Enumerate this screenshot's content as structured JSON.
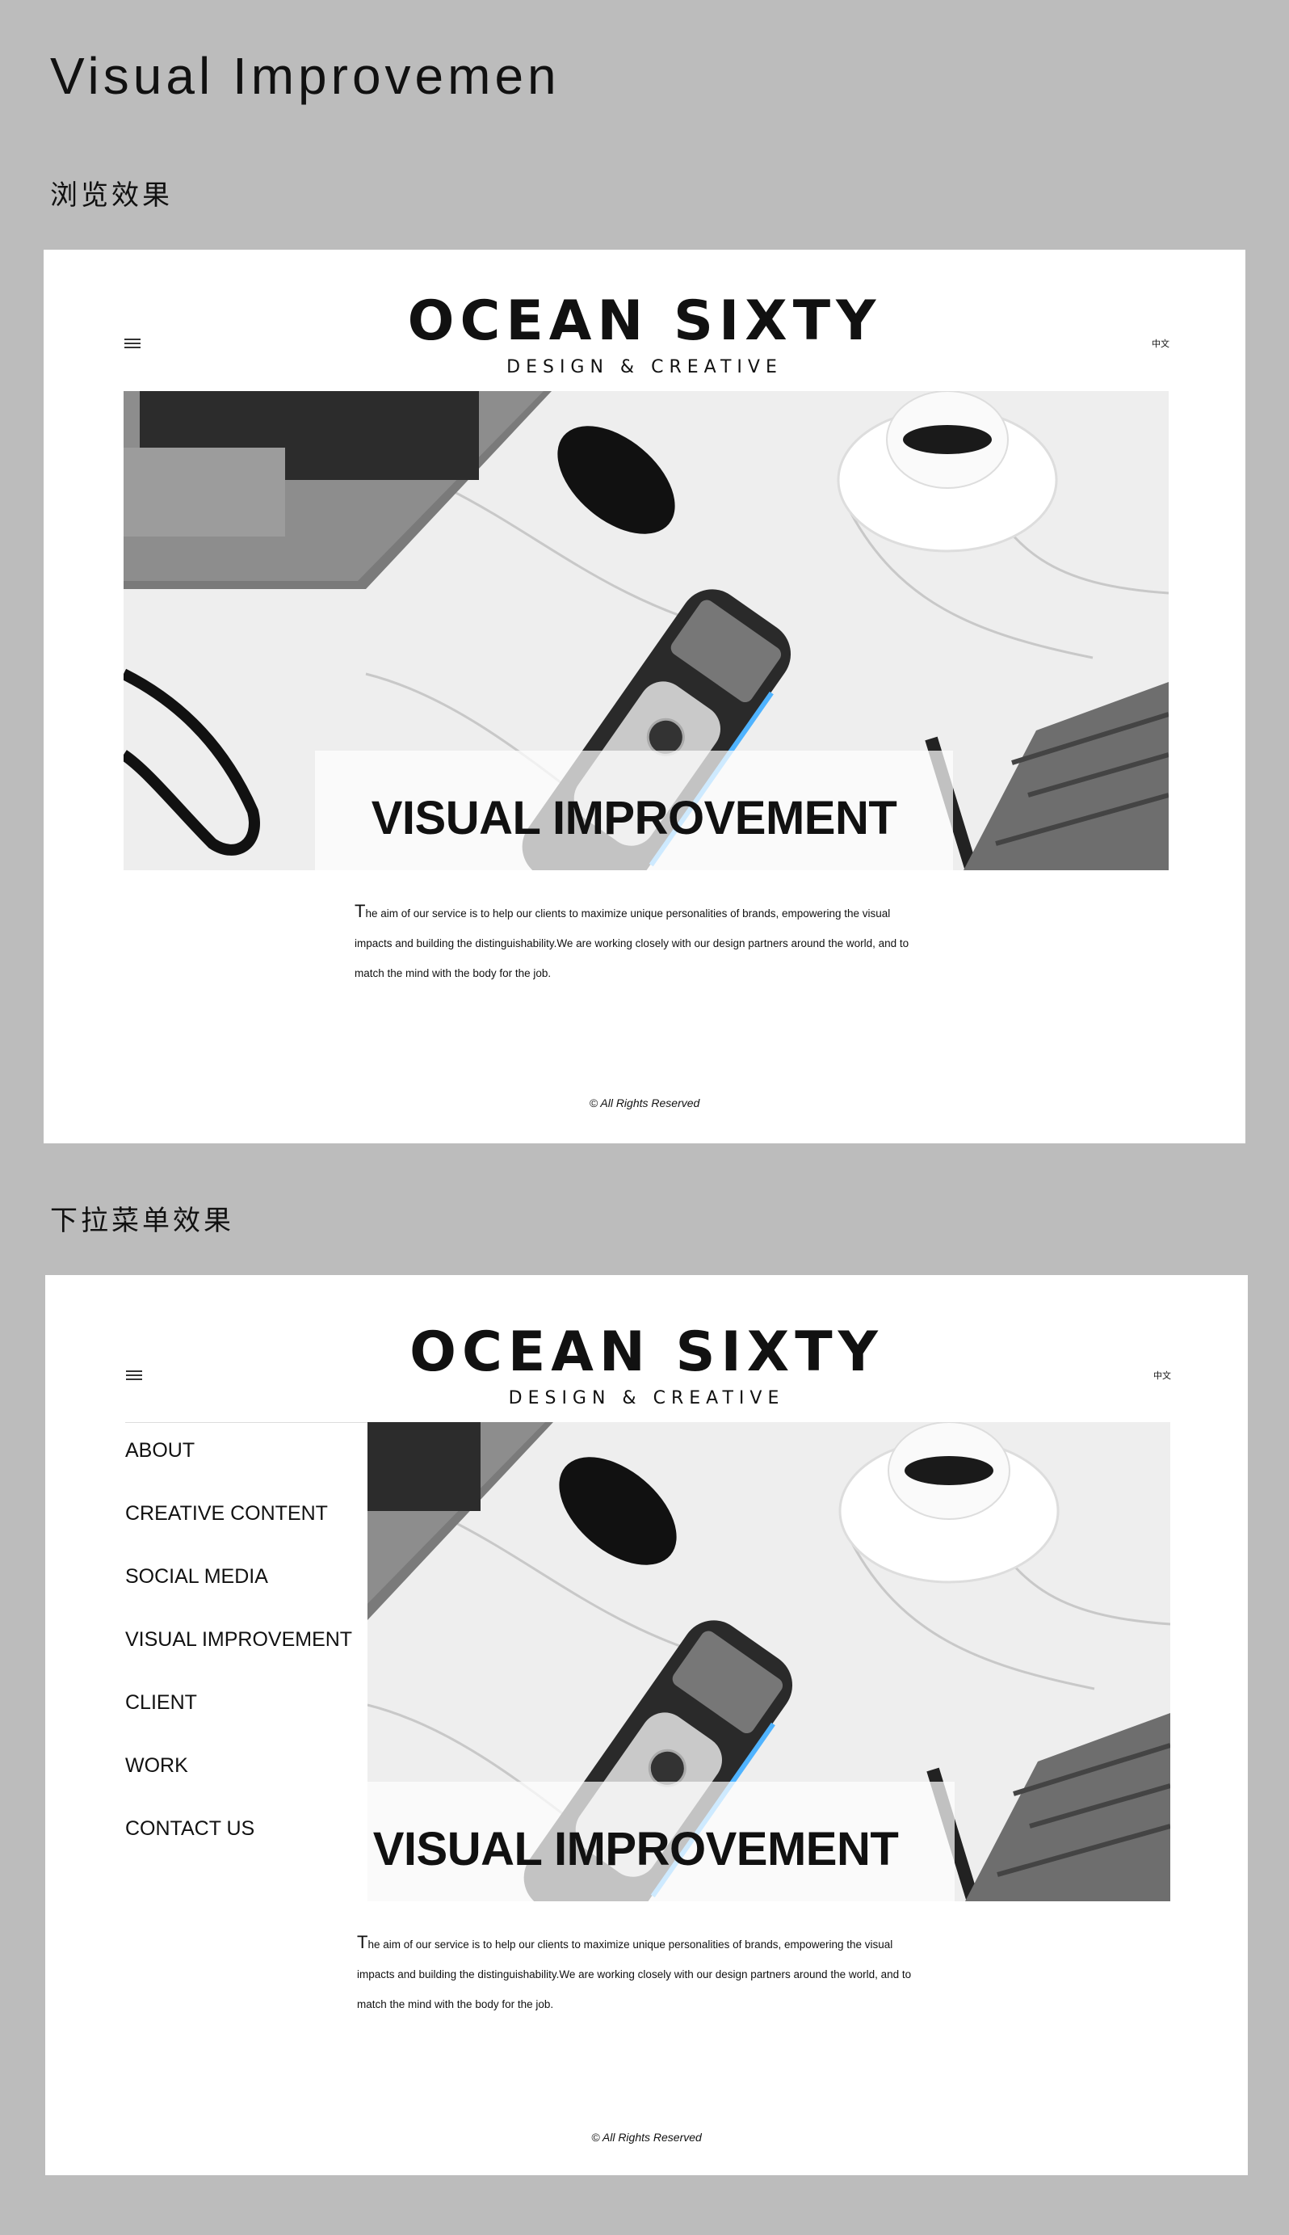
{
  "page": {
    "title": "Visual Improvemen",
    "section_browse": "浏览效果",
    "section_dropdown": "下拉菜单效果"
  },
  "site": {
    "logo_main": "OCEAN SIXTY",
    "logo_sub": "DESIGN & CREATIVE",
    "language": "中文",
    "hero_title": "VISUAL IMPROVEMENT",
    "body_first_letter": "T",
    "body_rest": "he aim of our service is to help our clients to maximize unique personalities of brands, empowering the visual impacts and building the distinguishability.We are working closely with our design partners around the world, and to match the mind with the body for the job.",
    "copyright": "© All Rights Reserved"
  },
  "menu": {
    "items": [
      {
        "label": "ABOUT"
      },
      {
        "label": "CREATIVE CONTENT"
      },
      {
        "label": "SOCIAL MEDIA"
      },
      {
        "label": "VISUAL IMPROVEMENT"
      },
      {
        "label": "CLIENT"
      },
      {
        "label": "WORK"
      },
      {
        "label": "CONTACT US"
      }
    ]
  },
  "colors": {
    "background": "#bcbcbc",
    "frame": "#ffffff",
    "text": "#111111",
    "accent_blue": "#4fb3ff"
  }
}
